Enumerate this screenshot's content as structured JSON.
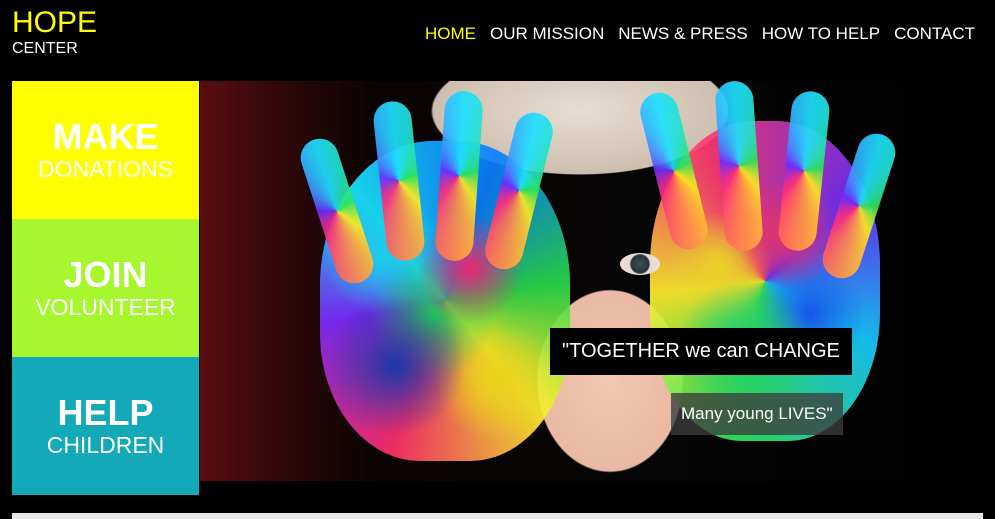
{
  "logo": {
    "title": "HOPE",
    "subtitle": "CENTER"
  },
  "nav": [
    {
      "label": "HOME",
      "active": true
    },
    {
      "label": "OUR MISSION"
    },
    {
      "label": "NEWS & PRESS"
    },
    {
      "label": "HOW TO HELP"
    },
    {
      "label": "CONTACT"
    }
  ],
  "tiles": [
    {
      "big": "MAKE",
      "small": "DONATIONS",
      "color": "#ffff00"
    },
    {
      "big": "JOIN",
      "small": "VOLUNTEER",
      "color": "#a6f72e"
    },
    {
      "big": "HELP",
      "small": "CHILDREN",
      "color": "#13a9b9"
    }
  ],
  "hero": {
    "caption_line1": "\"TOGETHER we can CHANGE",
    "caption_line2": "Many young LIVES\""
  },
  "colors": {
    "accent": "#ffff00",
    "background": "#000000"
  }
}
